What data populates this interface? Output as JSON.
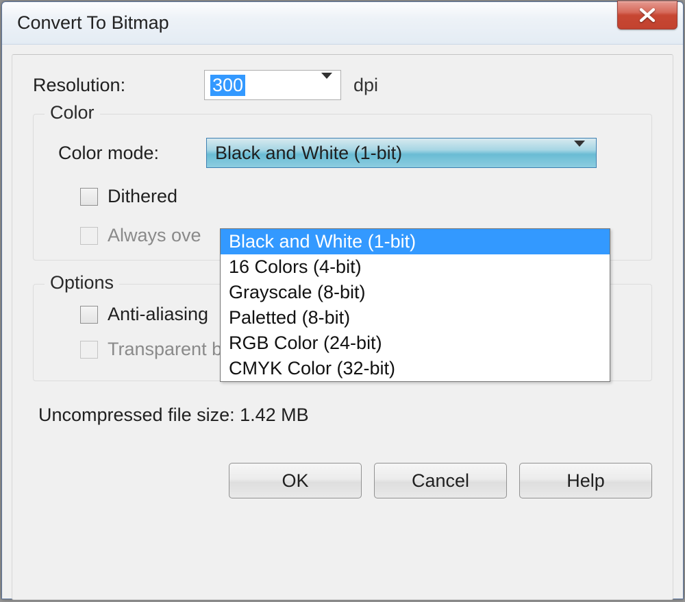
{
  "title": "Convert To Bitmap",
  "resolution": {
    "label": "Resolution:",
    "value": "300",
    "unit": "dpi"
  },
  "color_group": {
    "legend": "Color",
    "mode_label": "Color mode:",
    "mode_selected": "Black and White (1-bit)",
    "options": [
      "Black and White (1-bit)",
      "16 Colors (4-bit)",
      "Grayscale (8-bit)",
      "Paletted (8-bit)",
      "RGB Color (24-bit)",
      "CMYK Color (32-bit)"
    ],
    "dithered_label": "Dithered",
    "overprint_label": "Always ove"
  },
  "options_group": {
    "legend": "Options",
    "antialias_label": "Anti-aliasing",
    "transparent_label": "Transparent background"
  },
  "filesize_text": "Uncompressed file size: 1.42 MB",
  "buttons": {
    "ok": "OK",
    "cancel": "Cancel",
    "help": "Help"
  }
}
